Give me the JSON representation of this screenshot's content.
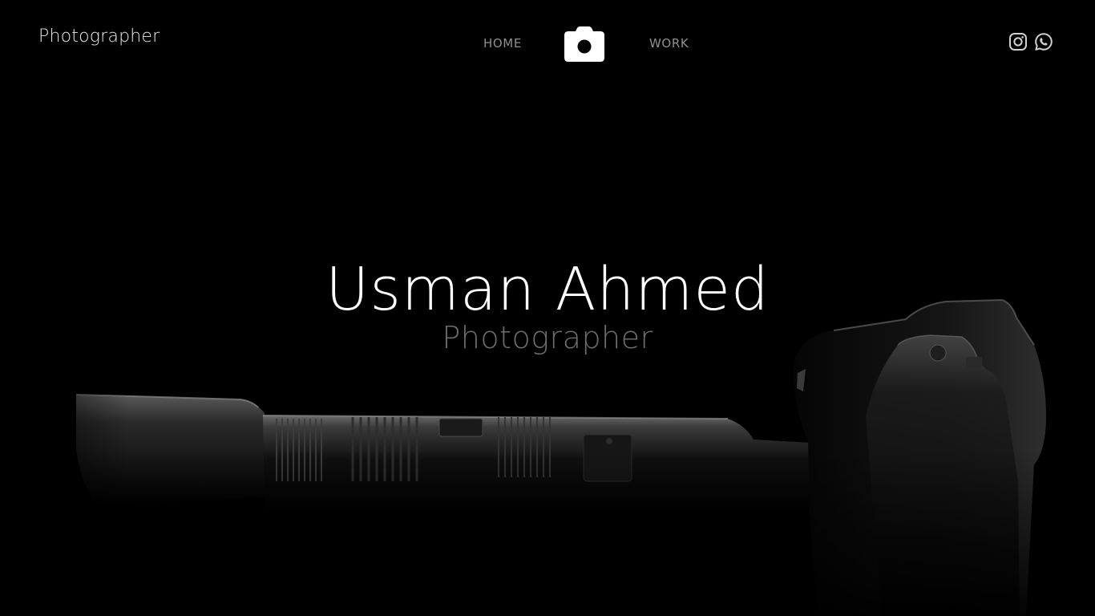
{
  "header": {
    "brand": "Photographer",
    "nav": {
      "home": "HOME",
      "work": "WORK"
    },
    "logo_icon": "camera-icon",
    "social": [
      {
        "icon": "instagram-icon"
      },
      {
        "icon": "whatsapp-icon"
      }
    ]
  },
  "hero": {
    "title": "Usman Ahmed",
    "subtitle": "Photographer",
    "background": "camera-with-telephoto-lens-photo"
  },
  "colors": {
    "background": "#000000",
    "title": "#ffffff",
    "subtitle": "#6e6e6e",
    "nav": "#8f8f8f",
    "brand": "#e9e9e9"
  }
}
